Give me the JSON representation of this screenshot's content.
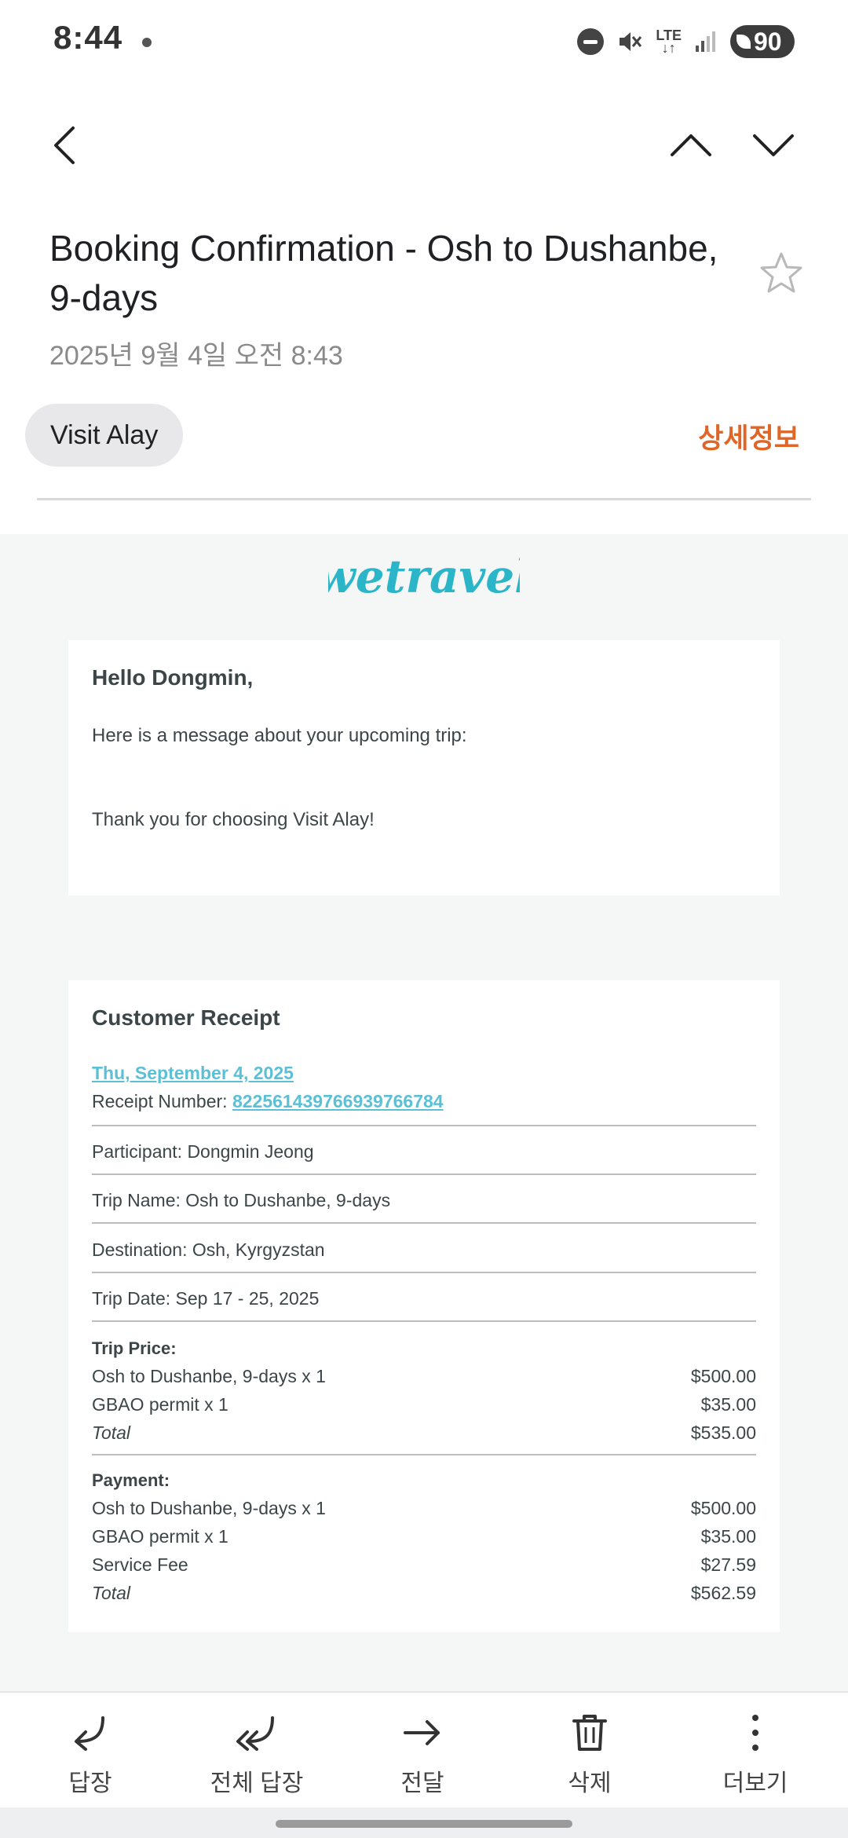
{
  "status_bar": {
    "time": "8:44",
    "network": "LTE",
    "battery": "90"
  },
  "subject": "Booking Confirmation - Osh to Dushanbe, 9-days",
  "date": "2025년 9월 4일  오전 8:43",
  "sender": "Visit Alay",
  "details_label": "상세정보",
  "logo_text": "wetravel",
  "greeting": "Hello Dongmin,",
  "message_intro": "Here is a message about your upcoming trip:",
  "message_thanks": "Thank you for choosing Visit Alay!",
  "receipt": {
    "title": "Customer Receipt",
    "date": "Thu, September 4, 2025",
    "number_label": "Receipt Number: ",
    "number": "822561439766939766784",
    "participant": "Participant: Dongmin Jeong",
    "trip_name": "Trip Name: Osh to Dushanbe, 9-days",
    "destination": "Destination: Osh, Kyrgyzstan",
    "trip_date": "Trip Date: Sep 17 - 25, 2025",
    "trip_price": {
      "title": "Trip Price:",
      "items": [
        {
          "label": "Osh to Dushanbe, 9-days x 1",
          "amount": "$500.00"
        },
        {
          "label": "GBAO permit x 1",
          "amount": "$35.00"
        },
        {
          "label": "Total",
          "amount": "$535.00"
        }
      ]
    },
    "payment": {
      "title": "Payment:",
      "items": [
        {
          "label": "Osh to Dushanbe, 9-days x 1",
          "amount": "$500.00"
        },
        {
          "label": "GBAO permit x 1",
          "amount": "$35.00"
        },
        {
          "label": "Service Fee",
          "amount": "$27.59"
        },
        {
          "label": "Total",
          "amount": "$562.59"
        }
      ]
    }
  },
  "actions": [
    {
      "label": "답장",
      "icon": "reply-icon"
    },
    {
      "label": "전체 답장",
      "icon": "reply-all-icon"
    },
    {
      "label": "전달",
      "icon": "forward-icon"
    },
    {
      "label": "삭제",
      "icon": "trash-icon"
    },
    {
      "label": "더보기",
      "icon": "more-vertical-icon"
    }
  ],
  "colors": {
    "accent_orange": "#e06627",
    "link_blue": "#5bc0d6",
    "wetravel_teal": "#2bb5c9"
  }
}
